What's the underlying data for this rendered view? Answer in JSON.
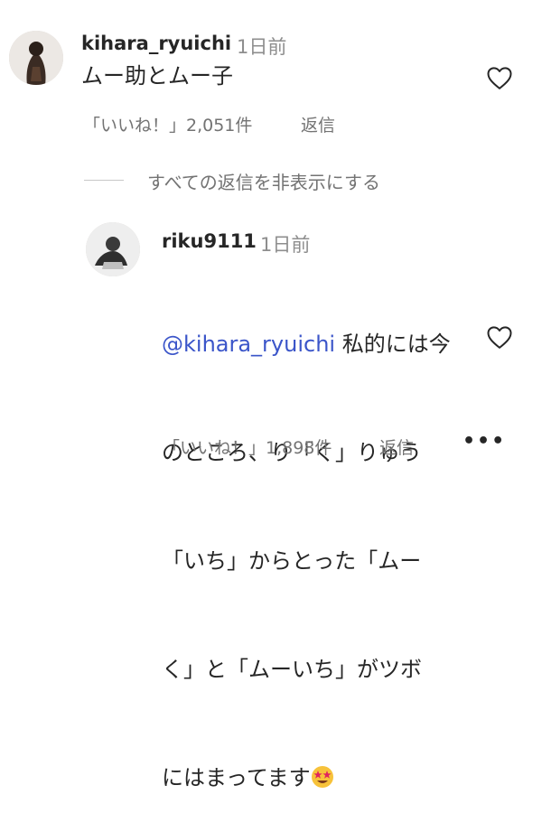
{
  "comment": {
    "username": "kihara_ryuichi",
    "time": "1日前",
    "text": "ムー助とムー子",
    "likes": "「いいね！」2,051件",
    "reply_label": "返信",
    "avatar": "person-photo"
  },
  "hide_replies_label": "すべての返信を非表示にする",
  "reply": {
    "username": "riku9111",
    "time": "1日前",
    "mention": "@kihara_ryuichi",
    "line1_rest": " 私的には今",
    "line2": "のところ、り「く」りゅう",
    "line3": "「いち」からとった「ムー",
    "line4": "く」と「ムーいち」がツボ",
    "line5": "にはまってます",
    "emoji": "star-struck-emoji",
    "likes": "「いいね！」1,898件",
    "reply_label": "返信",
    "more_label": "•••",
    "avatar": "person-photo"
  },
  "icons": {
    "like": "heart-outline-icon",
    "more": "more-dots-icon"
  }
}
